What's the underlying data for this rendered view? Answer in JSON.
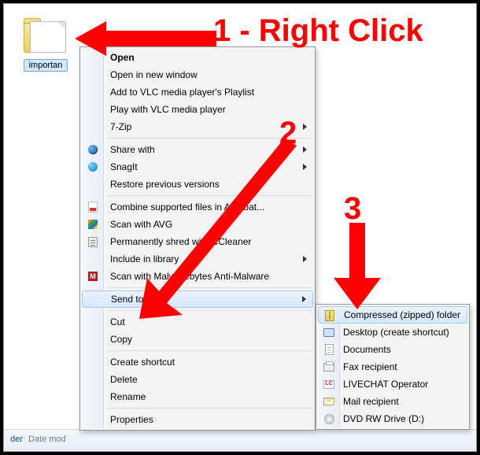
{
  "folder": {
    "label": "importan"
  },
  "details_bar": {
    "folder_label": "der",
    "mod_label": "Date mod"
  },
  "annotations": {
    "step1": "1 - Right Click",
    "step2": "2",
    "step3": "3"
  },
  "context_menu": {
    "open": "Open",
    "open_new_window": "Open in new window",
    "add_vlc_playlist": "Add to VLC media player's Playlist",
    "play_vlc": "Play with VLC media player",
    "seven_zip": "7-Zip",
    "share_with": "Share with",
    "snagit": "SnagIt",
    "restore_versions": "Restore previous versions",
    "acrobat_combine": "Combine supported files in Acrobat...",
    "scan_avg": "Scan with AVG",
    "shred_ccleaner": "Permanently shred with CCleaner",
    "include_library": "Include in library",
    "scan_malwarebytes": "Scan with Malwarebytes Anti-Malware",
    "send_to": "Send to",
    "cut": "Cut",
    "copy": "Copy",
    "create_shortcut": "Create shortcut",
    "delete": "Delete",
    "rename": "Rename",
    "properties": "Properties"
  },
  "send_to_menu": {
    "compressed": "Compressed (zipped) folder",
    "desktop_shortcut": "Desktop (create shortcut)",
    "documents": "Documents",
    "fax": "Fax recipient",
    "livechat": "LIVECHAT Operator",
    "mail": "Mail recipient",
    "dvd": "DVD RW Drive (D:)"
  }
}
